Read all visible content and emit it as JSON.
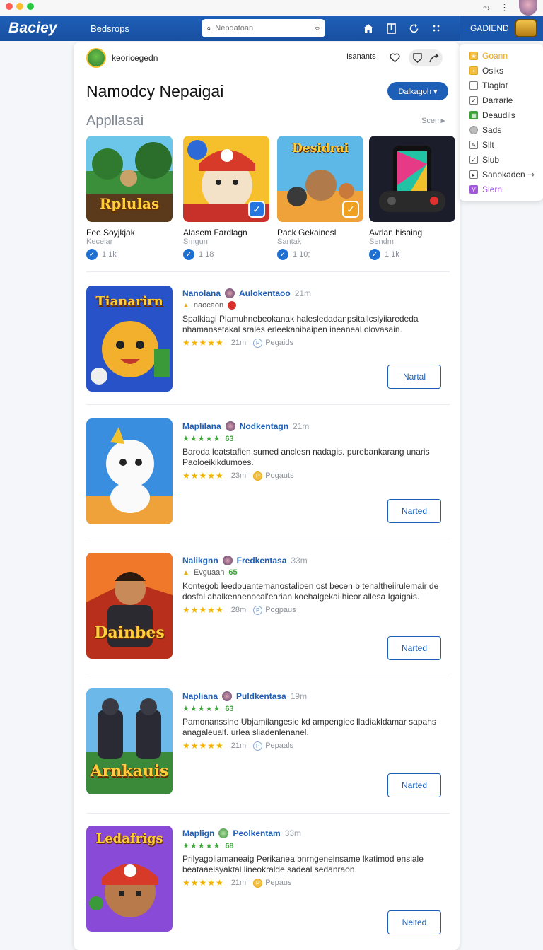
{
  "window": {
    "controls": [
      "close",
      "minimize",
      "maximize"
    ],
    "top_right_icons": [
      "share-icon",
      "more-icon",
      "avatar"
    ]
  },
  "navbar": {
    "brand": "Baciey",
    "link": "Bedsrops",
    "search_placeholder": "Nepdatoan",
    "icons": [
      "home-icon",
      "bookmark-icon",
      "refresh-icon",
      "apps-icon"
    ],
    "account_label": "GADIEND"
  },
  "profile": {
    "name": "keoricegedn",
    "right_label": "Isanants"
  },
  "page": {
    "title": "Namodcy Nepaigai",
    "primary_button": "Dalkagoh ▾",
    "section_title": "Appllasai",
    "section_link": "Scem▸"
  },
  "featured": [
    {
      "title": "Fee Soyjkjak",
      "sub": "Kecelar",
      "count": "1 1k",
      "art_text": "Rplulas"
    },
    {
      "title": "Alasem Fardlagn",
      "sub": "Smgun",
      "count": "1 18",
      "art_text": ""
    },
    {
      "title": "Pack Gekainesl",
      "sub": "Santak",
      "count": "1 10;",
      "art_text": "Desidrai"
    },
    {
      "title": "Avrlan hisaing",
      "sub": "Sendm",
      "count": "1 1k",
      "art_text": ""
    }
  ],
  "list": [
    {
      "name": "Nanolana",
      "author": "Aulokentaoo",
      "age": "21m",
      "meta_label": "naocaon",
      "score": "",
      "desc": "Spalkiagi Piamuhnebeokanak halesledadanpsitallcslyiiarededa nhamansetakal srales erleekanibaipen ineaneal olovasain.",
      "rating_age": "21m",
      "tag": "Pegaids",
      "button": "Nartal",
      "art_text": "Tianarirn"
    },
    {
      "name": "Maplilana",
      "author": "Nodkentagn",
      "age": "21m",
      "meta_label": "",
      "score": "63",
      "desc": "Baroda leatstafien sumed anclesn nadagis. purebankarang unaris Paoloeikikdumoes.",
      "rating_age": "23m",
      "tag": "Pogauts",
      "button": "Narted",
      "art_text": ""
    },
    {
      "name": "Nalikgnn",
      "author": "Fredkentasa",
      "age": "33m",
      "meta_label": "Evguaan",
      "score": "65",
      "desc": "Kontegob leedouantemanostalioen ost becen b tenaltheiirulemair de dosfal ahalkenaenocal'earian koehalgekai hieor allesa Igaigais.",
      "rating_age": "28m",
      "tag": "Pogpaus",
      "button": "Narted",
      "art_text": "Dainbes"
    },
    {
      "name": "Napliana",
      "author": "Puldkentasa",
      "age": "19m",
      "meta_label": "",
      "score": "63",
      "desc": "Pamonansslne Ubjamilangesie kd ampengiec lladiakldamar sapahs anagaleualt. urlea sliadenlenanel.",
      "rating_age": "21m",
      "tag": "Pepaals",
      "button": "Narted",
      "art_text": "Arnkauis"
    },
    {
      "name": "Maplign",
      "author": "Peolkentam",
      "age": "33m",
      "meta_label": "",
      "score": "68",
      "desc": "Prilyagoliamaneaig Perikanea bnrngeneinsame lkatimod ensiale beataaelsyaktal lineokralde sadeal sedanraon.",
      "rating_age": "21m",
      "tag": "Pepaus",
      "button": "Nelted",
      "art_text": "Ledafrigs"
    }
  ],
  "dropdown": [
    {
      "label": "Goann",
      "color": "#e7a922",
      "icon": "star-icon"
    },
    {
      "label": "Osiks",
      "color": "#e7a922",
      "icon": "lock-icon"
    },
    {
      "label": "Tlaglat",
      "color": "#555555",
      "icon": "tag-icon"
    },
    {
      "label": "Darrarle",
      "color": "#555555",
      "icon": "check-icon"
    },
    {
      "label": "Deaudils",
      "color": "#3da43a",
      "icon": "grid-icon"
    },
    {
      "label": "Sads",
      "color": "#888888",
      "icon": "circle-icon"
    },
    {
      "label": "Silt",
      "color": "#555555",
      "icon": "edit-icon"
    },
    {
      "label": "Slub",
      "color": "#555555",
      "icon": "check-icon"
    },
    {
      "label": "Sanokaden ⇾",
      "color": "#555555",
      "icon": "play-icon"
    },
    {
      "label": "Slern",
      "color": "#a259d9",
      "icon": "v-icon"
    }
  ],
  "colors": {
    "brand_blue": "#1d5fb6",
    "star_gold": "#f2b200",
    "score_green": "#3da43a"
  }
}
